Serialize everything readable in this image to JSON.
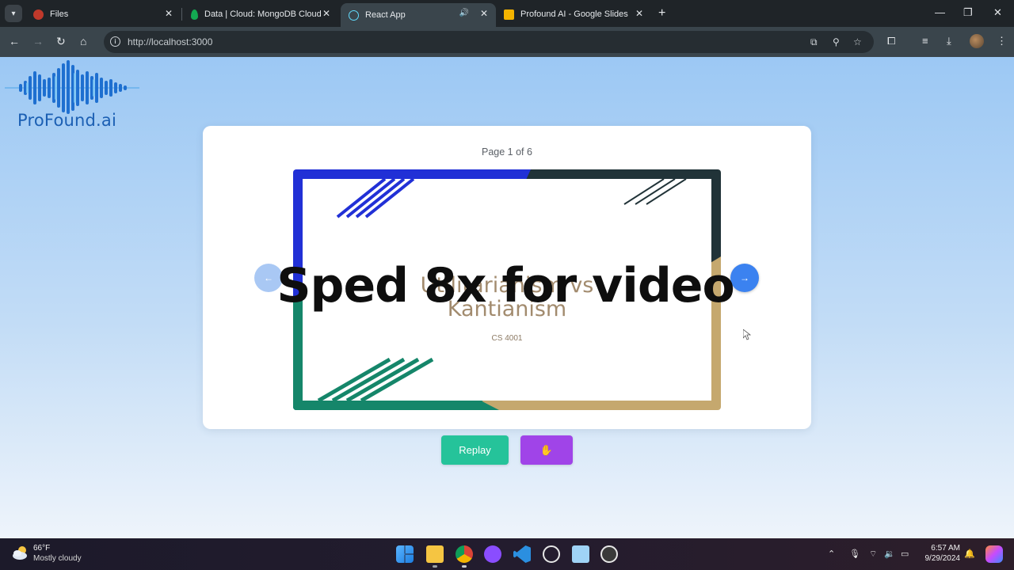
{
  "browser": {
    "tabs": [
      {
        "label": "Files",
        "active": false,
        "favicon_color": "#c0392b"
      },
      {
        "label": "Data | Cloud: MongoDB Cloud",
        "active": false,
        "favicon_color": "#13aa52"
      },
      {
        "label": "React App",
        "active": true,
        "favicon_color": "#61dafb",
        "audio": true
      },
      {
        "label": "Profound AI - Google Slides",
        "active": false,
        "favicon_color": "#f4b400"
      }
    ],
    "new_tab_label": "+",
    "url": "http://localhost:3000"
  },
  "page": {
    "logo_text": "ProFound.ai",
    "page_indicator": "Page 1 of 6",
    "slide": {
      "title_line1": "Utilitarianism vs",
      "title_line2": "Kantianism",
      "subtitle": "CS 4001"
    },
    "prev_arrow": "←",
    "next_arrow": "→",
    "overlay_text": "Sped 8x for video",
    "replay_label": "Replay",
    "hand_label": "✋",
    "colors": {
      "replay": "#25c39a",
      "hand": "#a044e8",
      "next": "#3b82f0",
      "prev": "#a9c8f4"
    }
  },
  "taskbar": {
    "temperature": "66°F",
    "condition": "Mostly cloudy",
    "time": "6:57 AM",
    "date": "9/29/2024",
    "pinned": [
      "windows-start",
      "file-explorer",
      "chrome",
      "github",
      "vscode",
      "chatgpt",
      "notepad",
      "media-player"
    ]
  }
}
